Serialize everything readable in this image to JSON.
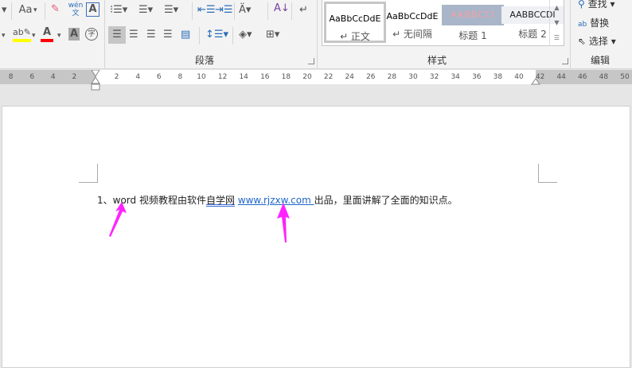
{
  "ribbon": {
    "font_row1": [
      "Aa",
      "wén文",
      "A"
    ],
    "paragraph_label": "段落",
    "styles_label": "样式",
    "editing_label": "编辑",
    "styles": [
      {
        "preview": "AaBbCcDdE",
        "name": "↵ 正文",
        "color": "#000000"
      },
      {
        "preview": "AaBbCcDdE",
        "name": "↵ 无间隔",
        "color": "#000000"
      },
      {
        "preview": "AABBCCI",
        "name": "标题 1",
        "color": "#f4a0a8"
      },
      {
        "preview": "AABBCCDI",
        "name": "标题 2",
        "color": "#222222"
      }
    ],
    "editing": {
      "find": "查找",
      "replace": "替换",
      "select": "选择"
    },
    "highlight_color": "#ffff00",
    "font_color": "#ff0000"
  },
  "ruler": {
    "left": [
      "8",
      "6",
      "4",
      "2"
    ],
    "right": [
      "2",
      "4",
      "6",
      "8",
      "10",
      "12",
      "14",
      "16",
      "18",
      "20",
      "22",
      "24",
      "26",
      "28",
      "30",
      "32",
      "34",
      "36",
      "38",
      "40",
      "42",
      "44",
      "46",
      "48",
      "50"
    ]
  },
  "document": {
    "prefix": "1、word 视频教程由软件",
    "underlined": "自学网",
    "link": "www.rjzxw.com ",
    "suffix": "出品，里面讲解了全面的知识点。"
  },
  "annotation_color": "#ff22ff"
}
